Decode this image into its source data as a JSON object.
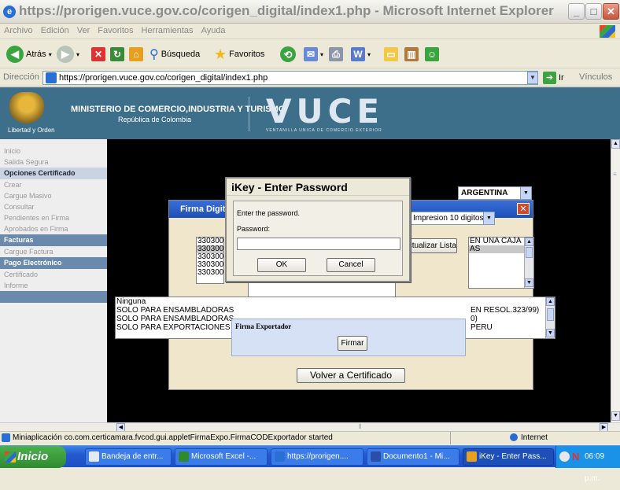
{
  "window": {
    "title": "https://prorigen.vuce.gov.co/corigen_digital/index1.php - Microsoft Internet Explorer"
  },
  "menu": [
    "Archivo",
    "Edición",
    "Ver",
    "Favoritos",
    "Herramientas",
    "Ayuda"
  ],
  "toolbar": {
    "back": "Atrás",
    "search": "Búsqueda",
    "favorites": "Favoritos"
  },
  "address": {
    "label": "Dirección",
    "url": "https://prorigen.vuce.gov.co/corigen_digital/index1.php",
    "go": "Ir",
    "links": "Vínculos"
  },
  "banner": {
    "ministry": "MINISTERIO DE COMERCIO,INDUSTRIA Y TURISMO",
    "republica": "República de Colombia",
    "motto": "Libertad y Orden",
    "logo": "VUCE",
    "logo_sub": "VENTANILLA UNICA DE COMERCIO EXTERIOR"
  },
  "sidebar": {
    "items_top": [
      "Inicio",
      "Salida Segura"
    ],
    "section1": "Opciones Certificado",
    "items1": [
      "Crear",
      "Cargue Masivo",
      "Consultar",
      "Pendientes en Firma",
      "Aprobados en Firma"
    ],
    "section2": "Facturas",
    "items2": [
      "Cargue Factura"
    ],
    "section3": "Pago Electrónico",
    "items3": [
      "Certificado",
      "Informe"
    ]
  },
  "page": {
    "country": "ARGENTINA",
    "impresion": "Impresion 10 digitos"
  },
  "applet": {
    "title": "Firma Digital",
    "codes": [
      "330300",
      "330300",
      "330300",
      "330300",
      "3303000"
    ],
    "actualizar": "Actualizar Lista",
    "right_list": [
      "EN UNA CAJA",
      "AS"
    ],
    "notes": [
      "Ninguna",
      "SOLO PARA ENSAMBLADORAS",
      "SOLO PARA ENSAMBLADORAS",
      "SOLO PARA EXPORTACIONES"
    ],
    "notes_right": [
      "EN RESOL.323/99)",
      "0)",
      "PERU"
    ],
    "exportador_label": "Firma Exportador",
    "firmar": "Firmar",
    "volver": "Volver a Certificado"
  },
  "ikey": {
    "title": "iKey - Enter Password",
    "prompt": "Enter the password.",
    "password_label": "Password:",
    "password_value": "",
    "ok": "OK",
    "cancel": "Cancel"
  },
  "status": {
    "text": "Miniaplicación co.com.certicamara.fvcod.gui.appletFirmaExpo.FirmaCODExportador started",
    "zone": "Internet"
  },
  "taskbar": {
    "start": "Inicio",
    "tasks": [
      "Bandeja de entr...",
      "Microsoft Excel -...",
      "https://prorigen....",
      "Documento1 - Mi...",
      "iKey - Enter Pass..."
    ],
    "clock": "06:09 p.m."
  }
}
